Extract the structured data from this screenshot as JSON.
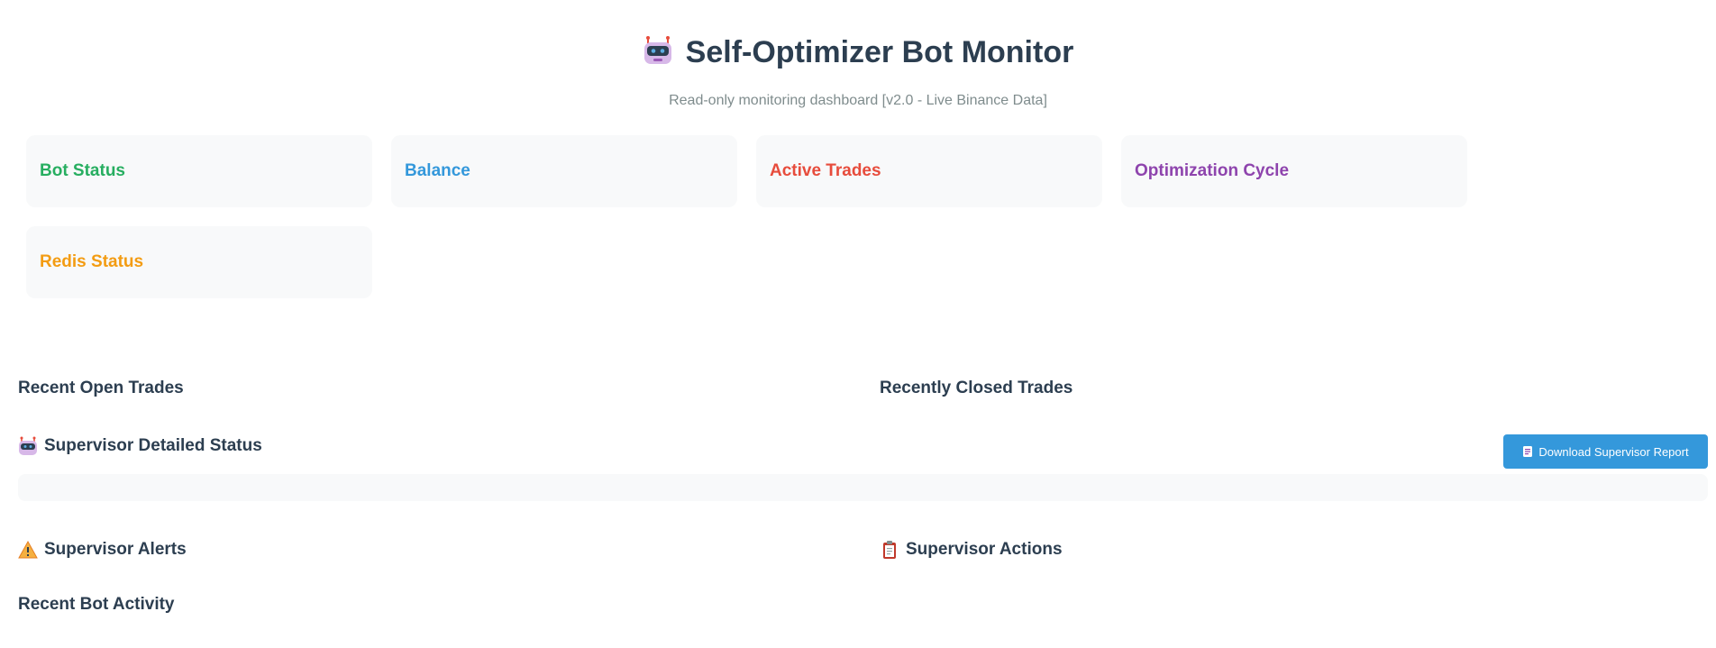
{
  "header": {
    "title": "Self-Optimizer Bot Monitor",
    "title_icon": "robot-icon",
    "subtitle": "Read-only monitoring dashboard [v2.0 - Live Binance Data]"
  },
  "cards": [
    {
      "label": "Bot Status",
      "color": "#27ae60"
    },
    {
      "label": "Balance",
      "color": "#3498db"
    },
    {
      "label": "Active Trades",
      "color": "#e74c3c"
    },
    {
      "label": "Optimization Cycle",
      "color": "#8e44ad"
    },
    {
      "label": "Redis Status",
      "color": "#f39c12"
    }
  ],
  "sections": {
    "open_trades": "Recent Open Trades",
    "closed_trades": "Recently Closed Trades",
    "supervisor_status": "Supervisor Detailed Status",
    "supervisor_alerts": "Supervisor Alerts",
    "supervisor_actions": "Supervisor Actions",
    "bot_activity": "Recent Bot Activity"
  },
  "buttons": {
    "download_report": "Download Supervisor Report",
    "download_icon": "report-icon"
  },
  "colors": {
    "accent": "#3498db",
    "heading": "#2c3e50",
    "muted": "#7f8c8d",
    "panel": "#f8f9fa"
  }
}
